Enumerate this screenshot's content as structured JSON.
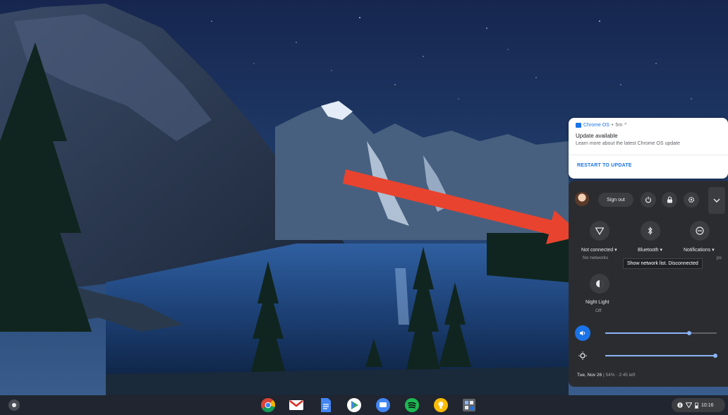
{
  "notification": {
    "app_name": "Chrome OS",
    "separator": "•",
    "time": "5m",
    "expand_glyph": "^",
    "title": "Update available",
    "message": "Learn more about the latest Chrome OS update",
    "action_label": "RESTART TO UPDATE"
  },
  "tray": {
    "sign_out_label": "Sign out",
    "header_icons": [
      "power-icon",
      "lock-icon",
      "settings-icon",
      "chevron-down-icon"
    ],
    "features": [
      {
        "label": "Not connected ▾",
        "sublabel": "No networks",
        "icon": "wifi-icon"
      },
      {
        "label": "Bluetooth ▾",
        "sublabel": "",
        "icon": "bluetooth-icon"
      },
      {
        "label": "Notifications ▾",
        "sublabel": "ps",
        "icon": "do-not-disturb-icon"
      },
      {
        "label": "Night Light",
        "sublabel": "Off",
        "icon": "night-light-icon"
      }
    ],
    "tooltip": "Show network list. Disconnected",
    "volume_level": 0.75,
    "brightness_level": 0.99,
    "date": "Tue, Nov 26",
    "battery": "54% · 2:45 left"
  },
  "shelf": {
    "apps": [
      "chrome-icon",
      "gmail-icon",
      "docs-icon",
      "play-store-icon",
      "messages-icon",
      "spotify-icon",
      "keep-icon",
      "files-icon"
    ],
    "clock": "10:16"
  },
  "colors": {
    "arrow": "#e8432e",
    "accent": "#1a73e8",
    "tray_bg": "#2b2c30"
  }
}
